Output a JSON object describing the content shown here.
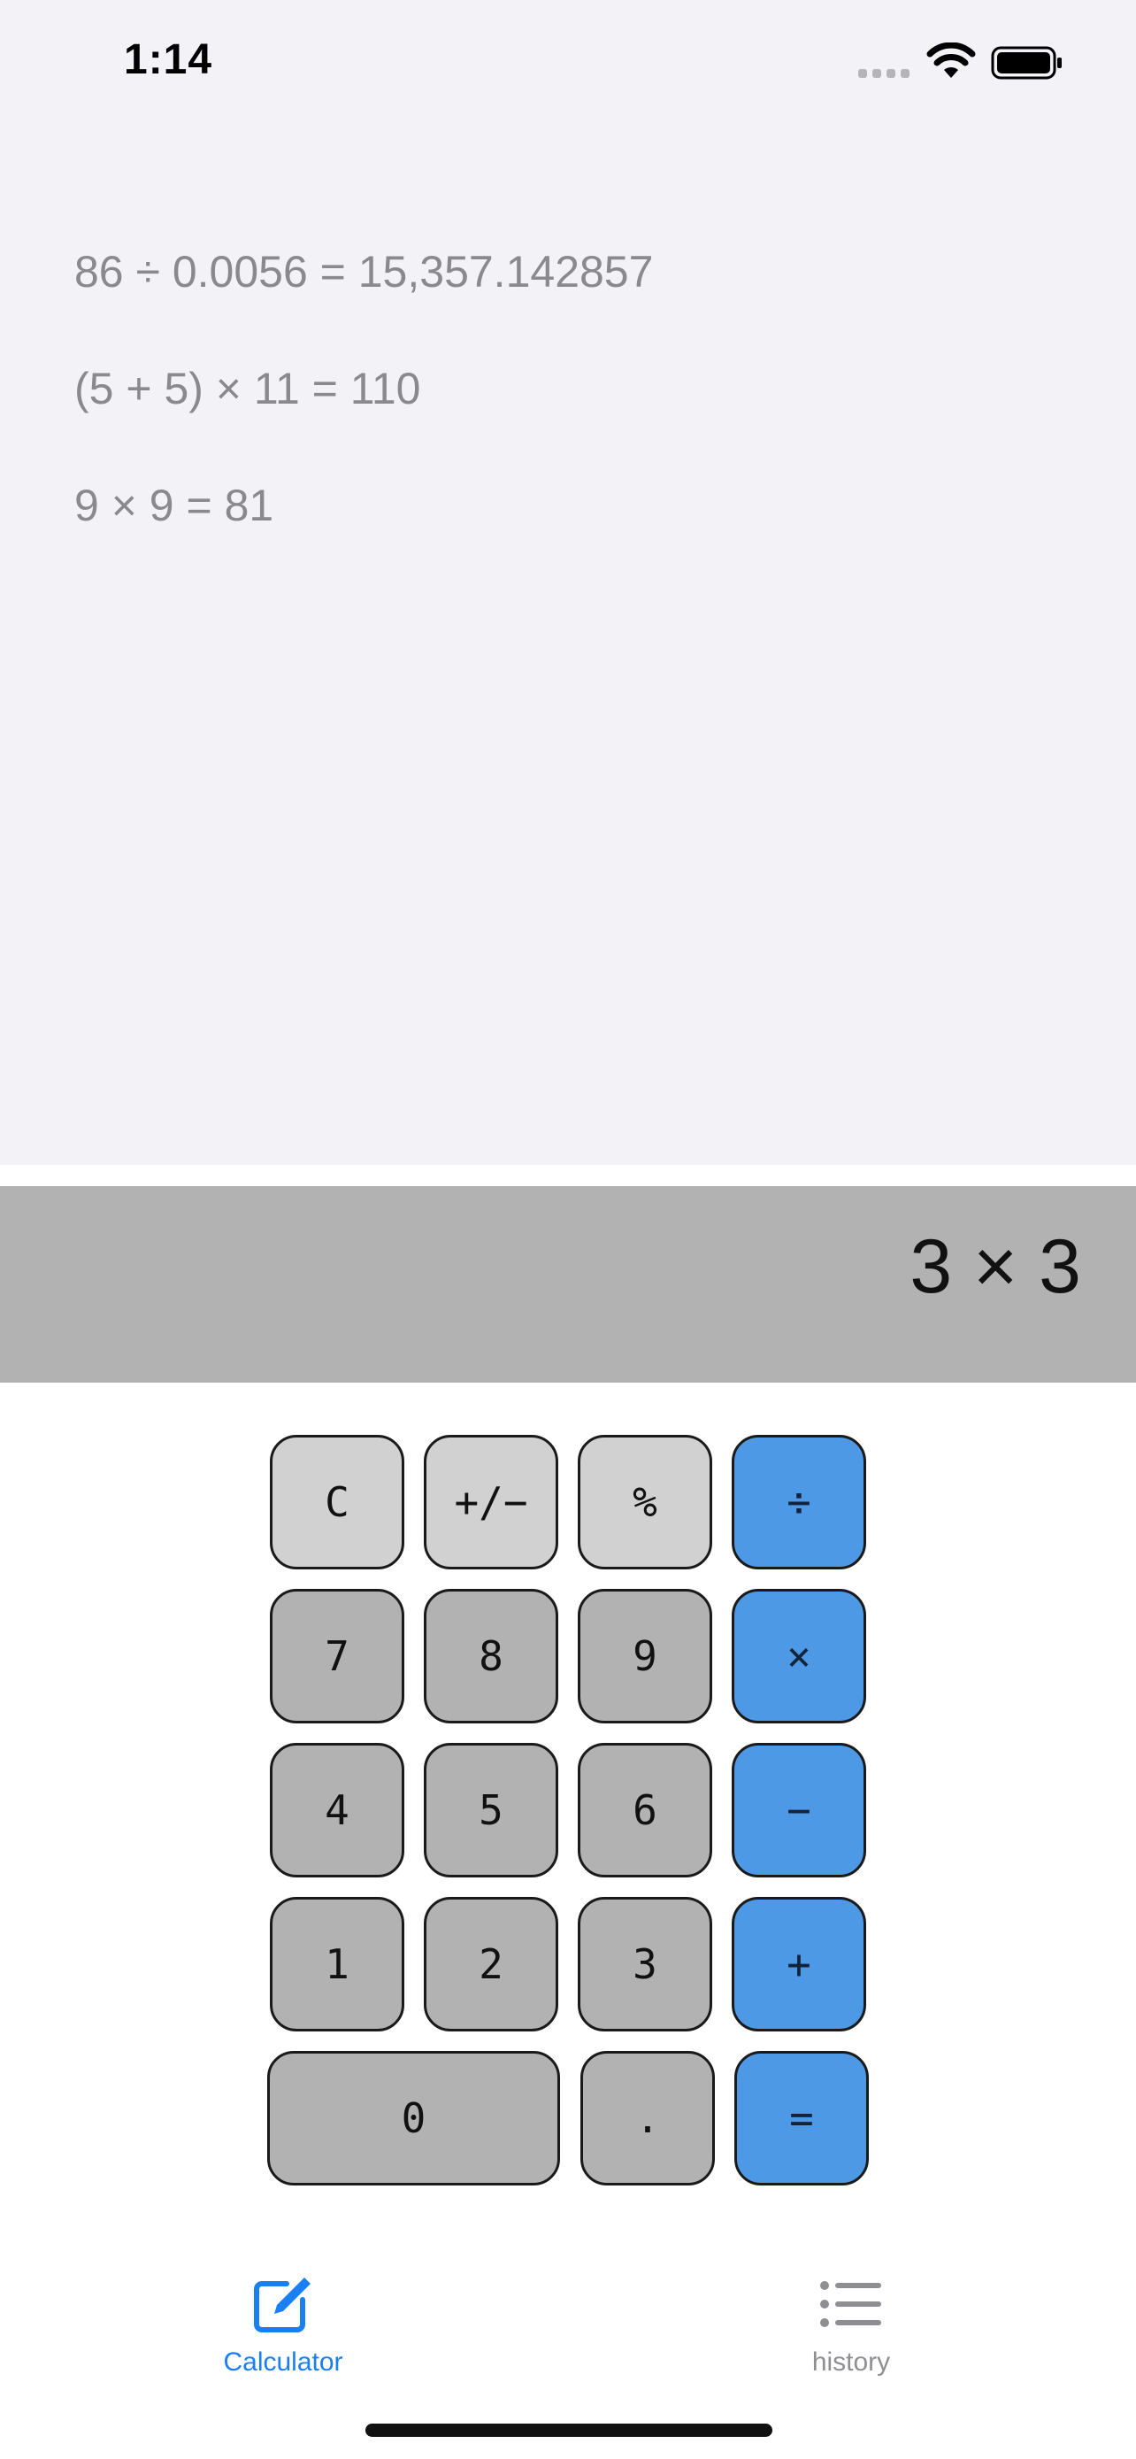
{
  "status_bar": {
    "time": "1:14"
  },
  "history": [
    "86 ÷ 0.0056 = 15,357.142857",
    "(5 + 5) × 11 = 110",
    "9 × 9 = 81"
  ],
  "display": {
    "expression": "3 × 3"
  },
  "keypad": {
    "row1": [
      "C",
      "+/−",
      "%",
      "÷"
    ],
    "row2": [
      "7",
      "8",
      "9",
      "×"
    ],
    "row3": [
      "4",
      "5",
      "6",
      "−"
    ],
    "row4": [
      "1",
      "2",
      "3",
      "+"
    ],
    "row5": [
      "0",
      ".",
      "="
    ]
  },
  "tabs": [
    {
      "label": "Calculator",
      "icon": "compose-icon",
      "active": true
    },
    {
      "label": "history",
      "icon": "list-icon",
      "active": false
    }
  ],
  "colors": {
    "accent": "#1a7ff0",
    "operator_key": "#4e99e6",
    "function_key": "#d1d1d1",
    "digit_key": "#b2b2b2",
    "display_bg": "#b2b2b2",
    "history_bg": "#f2f2f7",
    "inactive_tab": "#8e8e93"
  }
}
